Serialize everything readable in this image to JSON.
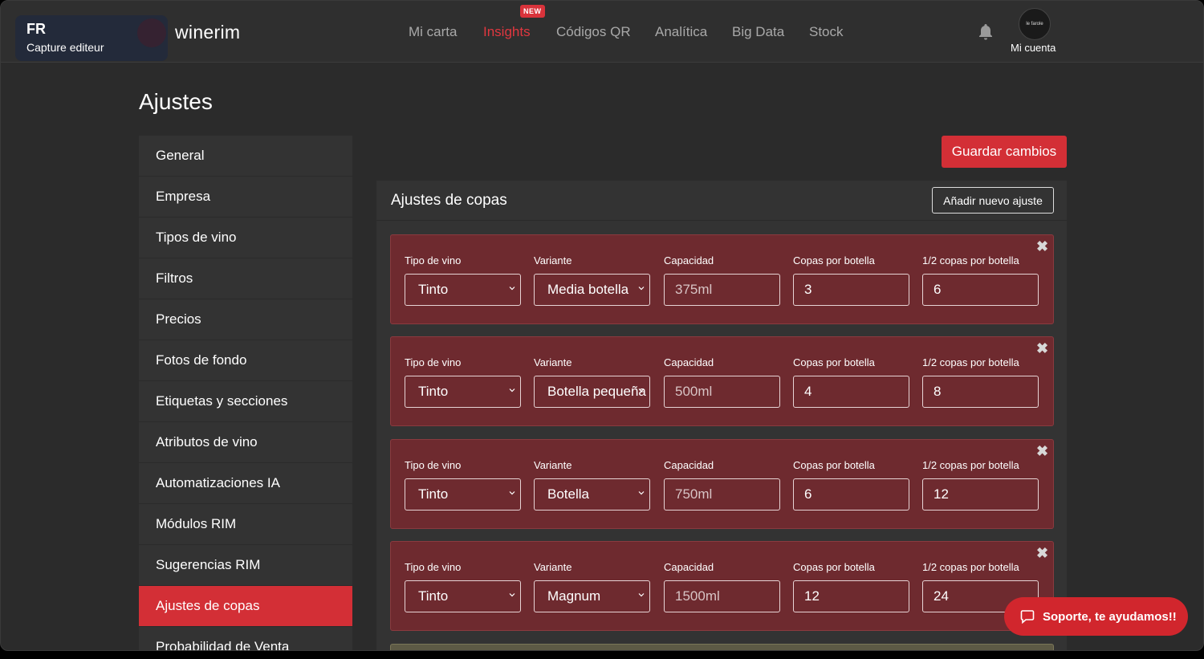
{
  "brand": {
    "code": "FR",
    "subtitle": "Capture editeur",
    "logo": "winerim"
  },
  "nav": {
    "items": [
      "Mi carta",
      "Insights",
      "Códigos QR",
      "Analítica",
      "Big Data",
      "Stock"
    ],
    "active": "Insights",
    "new_badge": "NEW"
  },
  "account": {
    "label": "Mi cuenta",
    "avatar_text": "le farole"
  },
  "page": {
    "title": "Ajustes"
  },
  "sidebar": {
    "items": [
      "General",
      "Empresa",
      "Tipos de vino",
      "Filtros",
      "Precios",
      "Fotos de fondo",
      "Etiquetas y secciones",
      "Atributos de vino",
      "Automatizaciones IA",
      "Módulos RIM",
      "Sugerencias RIM",
      "Ajustes de copas",
      "Probabilidad de Venta"
    ],
    "selected": "Ajustes de copas"
  },
  "actions": {
    "save": "Guardar cambios",
    "add": "Añadir nuevo ajuste"
  },
  "panel": {
    "title": "Ajustes de copas",
    "labels": {
      "type": "Tipo de vino",
      "variant": "Variante",
      "capacity": "Capacidad",
      "glasses": "Copas por botella",
      "half": "1/2 copas por botella"
    },
    "rows": [
      {
        "type": "Tinto",
        "variant": "Media botella",
        "capacity": "375ml",
        "glasses": "3",
        "half": "6"
      },
      {
        "type": "Tinto",
        "variant": "Botella pequeña",
        "capacity": "500ml",
        "glasses": "4",
        "half": "8"
      },
      {
        "type": "Tinto",
        "variant": "Botella",
        "capacity": "750ml",
        "glasses": "6",
        "half": "12"
      },
      {
        "type": "Tinto",
        "variant": "Magnum",
        "capacity": "1500ml",
        "glasses": "12",
        "half": "24"
      }
    ]
  },
  "support": {
    "label": "Soporte, te ayudamos!!"
  },
  "colors": {
    "accent": "#d32f36",
    "row_bg": "#6e2a2f",
    "bg": "#2b2b2b"
  }
}
